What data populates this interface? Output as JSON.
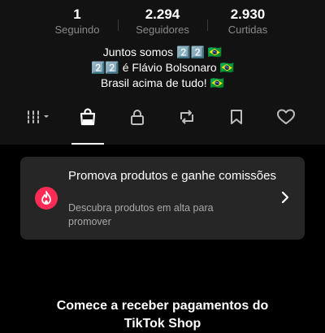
{
  "stats": [
    {
      "value": "1",
      "label": "Seguindo"
    },
    {
      "value": "2.294",
      "label": "Seguidores"
    },
    {
      "value": "2.930",
      "label": "Curtidas"
    }
  ],
  "bio": {
    "line1": "Juntos somos 2️⃣2️⃣ 🇧🇷",
    "line2": "2️⃣2️⃣ é Flávio Bolsonaro 🇧🇷",
    "line3": "Brasil acima de tudo! 🇧🇷"
  },
  "tabs": [
    {
      "icon": "videos-grid-icon",
      "active": false
    },
    {
      "icon": "shopping-bag-icon",
      "active": true
    },
    {
      "icon": "lock-icon",
      "active": false
    },
    {
      "icon": "repost-icon",
      "active": false
    },
    {
      "icon": "bookmark-icon",
      "active": false
    },
    {
      "icon": "heart-icon",
      "active": false
    }
  ],
  "promo": {
    "title": "Promova produtos e ganhe comissões",
    "subtitle": "Descubra produtos em alta para promover",
    "icon": "fire-icon",
    "accent": "#fe2c55"
  },
  "shop": {
    "heading_line1": "Comece a receber pagamentos do",
    "heading_line2": "TikTok Shop"
  }
}
